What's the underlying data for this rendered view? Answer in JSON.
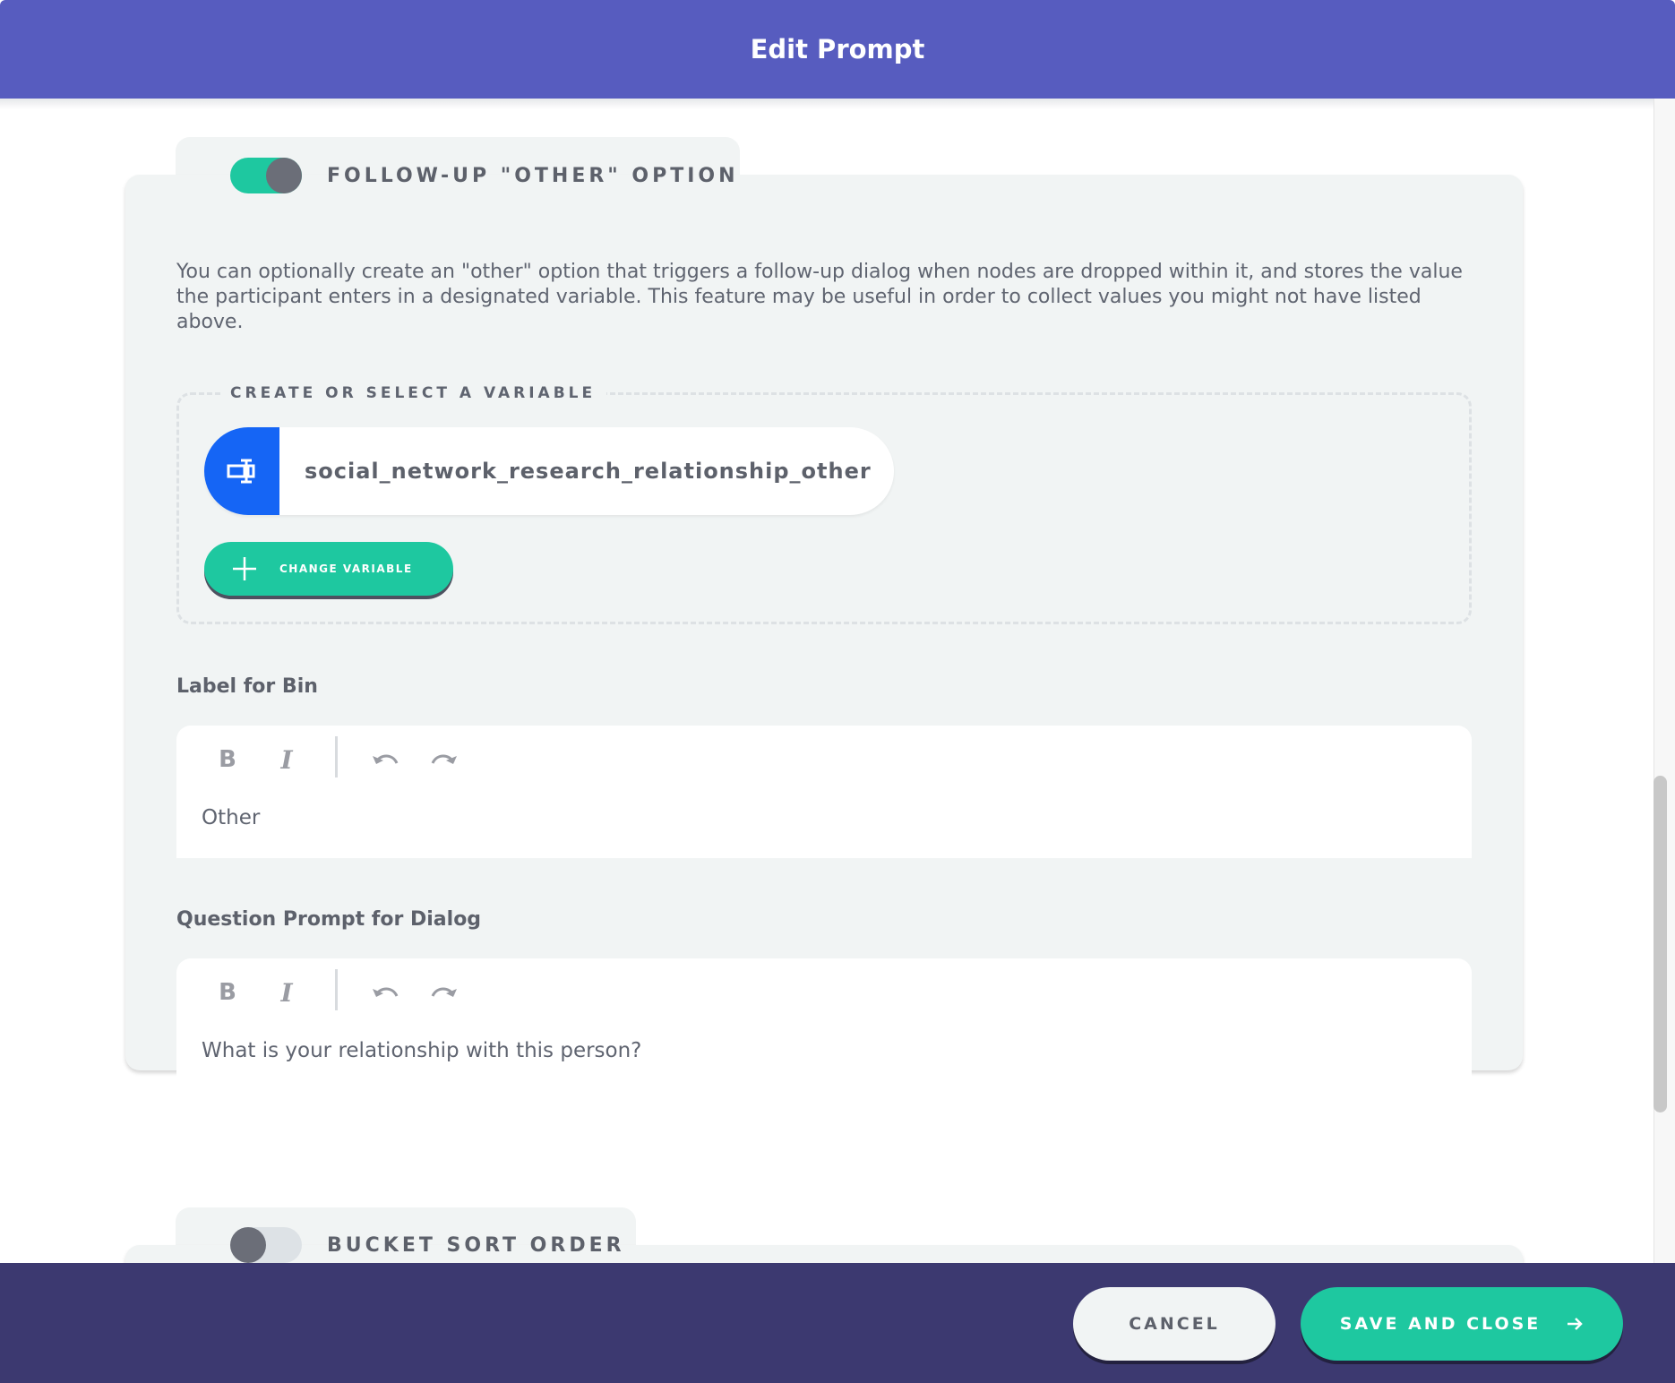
{
  "header": {
    "title": "Edit Prompt"
  },
  "followup_section": {
    "title": "Follow-up \"Other\" option",
    "enabled": true,
    "description": "You can optionally create an \"other\" option that triggers a follow-up dialog when nodes are dropped within it, and stores the value the participant enters in a designated variable. This feature may be useful in order to collect values you might not have listed above.",
    "variable_legend": "CREATE OR SELECT A VARIABLE",
    "variable_name": "social_network_research_relationship_other",
    "variable_icon": "text-variable-icon",
    "change_variable_label": "CHANGE VARIABLE",
    "label_for_bin": {
      "label": "Label for Bin",
      "value": "Other",
      "toolbar": {
        "bold": "B",
        "italic": "I"
      }
    },
    "question_prompt": {
      "label": "Question Prompt for Dialog",
      "value": "What is your relationship with this person?",
      "toolbar": {
        "bold": "B",
        "italic": "I"
      }
    }
  },
  "bucket_sort_section": {
    "title": "Bucket sort order",
    "enabled": false
  },
  "footer": {
    "cancel_label": "CANCEL",
    "save_label": "SAVE AND CLOSE"
  },
  "colors": {
    "header": "#575cbf",
    "footer": "#3c3970",
    "accent_green": "#1ec8a0",
    "variable_blue": "#1565f5",
    "card_bg": "#f1f4f4"
  }
}
